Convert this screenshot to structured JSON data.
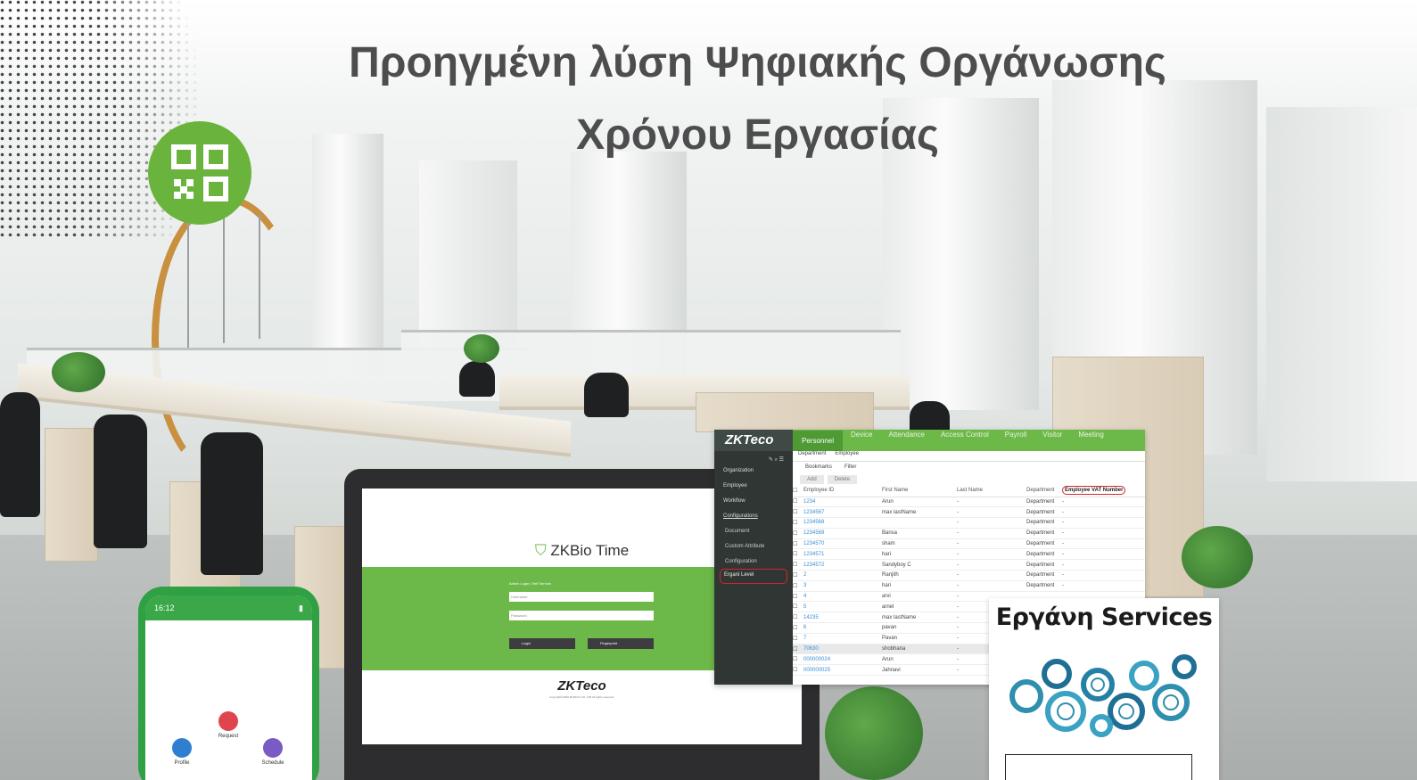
{
  "headline": {
    "line1": "Προηγμένη  λύση Ψηφιακής Οργάνωσης",
    "line2": "Χρόνου Εργασίας"
  },
  "icons": {
    "qr_badge": "qr-code-icon",
    "ergani_gears": "gears-services-icon"
  },
  "colors": {
    "brand_green": "#6ab43e",
    "title_gray": "#4d4d4f",
    "highlight_red": "#d9242a"
  },
  "phone": {
    "status_time": "16:12",
    "buttons": [
      "Request",
      "Profile",
      "Schedule"
    ]
  },
  "laptop": {
    "brand": "ZKBio Time",
    "login_tabs": "Admin Login  |  Self Service",
    "username_placeholder": "Username",
    "password_placeholder": "Password",
    "login_button": "Login",
    "fingerprint_button": "Fingerprint",
    "footer_logo": "ZKTeco",
    "copyright": "Copyright©2020 ZKTECO CO.,LTD All rights reserved."
  },
  "app": {
    "logo": "ZKTeco",
    "nav": [
      "Personnel",
      "Device",
      "Attendance",
      "Access Control",
      "Payroll",
      "Visitor",
      "Meeting"
    ],
    "sidebar": [
      "Organization",
      "Employee",
      "Workflow",
      "Configurations",
      "Document",
      "Custom Attribute",
      "Configuration",
      "Ergani Level"
    ],
    "subtabs": [
      "Department",
      "Employee"
    ],
    "toolbar": [
      "Bookmarks",
      "Filter"
    ],
    "actions": [
      "Add",
      "Delete"
    ],
    "columns": [
      "Employee ID",
      "First Name",
      "Last Name",
      "Department",
      "Employee VAT Number"
    ],
    "rows": [
      [
        "1234",
        "Arun",
        "-",
        "Department",
        "-"
      ],
      [
        "1234567",
        "max lastName",
        "-",
        "Department",
        "-"
      ],
      [
        "1234568",
        "",
        "-",
        "Department",
        "-"
      ],
      [
        "1234569",
        "Bansa",
        "-",
        "Department",
        "-"
      ],
      [
        "1234570",
        "sham",
        "-",
        "Department",
        "-"
      ],
      [
        "1234571",
        "hari",
        "-",
        "Department",
        "-"
      ],
      [
        "1234572",
        "Sandyboy C",
        "-",
        "Department",
        "-"
      ],
      [
        "2",
        "Ranjith",
        "-",
        "Department",
        "-"
      ],
      [
        "3",
        "hari",
        "-",
        "Department",
        "-"
      ],
      [
        "4",
        "arvi",
        "-",
        "",
        ""
      ],
      [
        "5",
        "arnel",
        "-",
        "",
        ""
      ],
      [
        "14235",
        "max lastName",
        "-",
        "",
        ""
      ],
      [
        "6",
        "pavan",
        "-",
        "",
        ""
      ],
      [
        "7",
        "Pavan",
        "-",
        "",
        ""
      ],
      [
        "70630",
        "shobhana",
        "-",
        "",
        ""
      ],
      [
        "000000024",
        "Arun",
        "-",
        "",
        ""
      ],
      [
        "000000025",
        "Jahnavi",
        "-",
        "",
        ""
      ]
    ]
  },
  "ergani": {
    "title": "Εργάνη Services"
  }
}
